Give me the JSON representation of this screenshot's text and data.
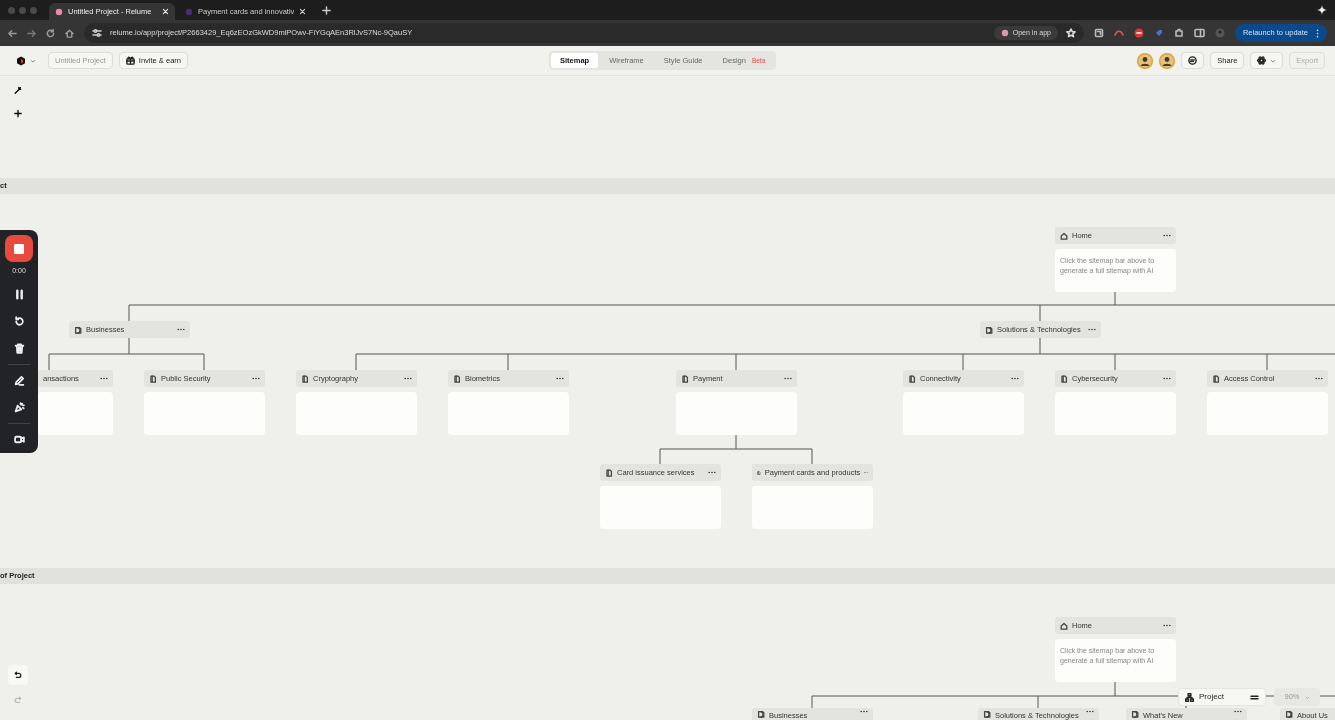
{
  "browser": {
    "tabs": [
      {
        "title": "Untitled Project - Relume",
        "selected": true
      },
      {
        "title": "Payment cards and innovativ",
        "selected": false
      }
    ],
    "url": "relume.io/app/project/P2663429_Eq6zEOzGkWD9mlPOwv-FiYGqAEn3RlJvS7Nc-9QauSY",
    "open_in_app": "Open in app",
    "relaunch": "Relaunch to update"
  },
  "header": {
    "project_name": "Untitled Project",
    "invite": "Invite & earn",
    "view_tabs": [
      {
        "label": "Sitemap",
        "selected": true
      },
      {
        "label": "Wireframe",
        "selected": false
      },
      {
        "label": "Style Guide",
        "selected": false
      },
      {
        "label": "Design",
        "selected": false,
        "badge": "Beta"
      }
    ],
    "share": "Share",
    "export": {
      "label": "Export",
      "disabled": true
    }
  },
  "recorder": {
    "time": "0:00"
  },
  "sections": [
    {
      "label": "ct",
      "tree": {
        "title": "Home",
        "kind": "home",
        "description": "Click the sitemap bar above to generate a full sitemap with AI",
        "children": [
          {
            "title": "Businesses",
            "kind": "folder",
            "children": [
              {
                "title": "ansactions",
                "kind": "page"
              },
              {
                "title": "Public Security",
                "kind": "page"
              }
            ]
          },
          {
            "title": "Solutions & Technologies",
            "kind": "folder",
            "children": [
              {
                "title": "Cryptography",
                "kind": "page"
              },
              {
                "title": "Biometrics",
                "kind": "page"
              },
              {
                "title": "Payment",
                "kind": "page",
                "children": [
                  {
                    "title": "Card issuance services",
                    "kind": "page"
                  },
                  {
                    "title": "Payment cards and products",
                    "kind": "page"
                  }
                ]
              },
              {
                "title": "Connectivity",
                "kind": "page"
              },
              {
                "title": "Cybersecurity",
                "kind": "page"
              },
              {
                "title": "Access Control",
                "kind": "page"
              }
            ]
          }
        ]
      }
    },
    {
      "label": "of Project",
      "tree": {
        "title": "Home",
        "kind": "home",
        "description": "Click the sitemap bar above to generate a full sitemap with AI",
        "children": [
          {
            "title": "Businesses",
            "kind": "folder"
          },
          {
            "title": "Solutions & Technologies",
            "kind": "folder"
          },
          {
            "title": "What's New",
            "kind": "folder"
          },
          {
            "title": "About Us",
            "kind": "folder"
          }
        ]
      }
    }
  ],
  "footer": {
    "undo": {
      "disabled": false
    },
    "redo": {
      "disabled": true
    },
    "project": "Project",
    "zoom": "90%"
  }
}
